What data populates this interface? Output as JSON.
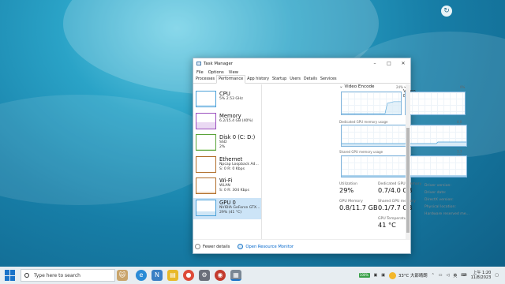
{
  "window": {
    "title": "Task Manager",
    "menu": [
      "File",
      "Options",
      "View"
    ],
    "tabs": [
      "Processes",
      "Performance",
      "App history",
      "Startup",
      "Users",
      "Details",
      "Services"
    ],
    "active_tab": "Performance"
  },
  "sidebar": {
    "items": [
      {
        "name": "CPU",
        "line1": "5% 2.53 GHz",
        "line2": ""
      },
      {
        "name": "Memory",
        "line1": "6.2/15.4 GB (40%)",
        "line2": ""
      },
      {
        "name": "Disk 0 (C: D:)",
        "line1": "SSD",
        "line2": "2%"
      },
      {
        "name": "Ethernet",
        "line1": "Npcap Loopback Ad...",
        "line2": "S: 0 R: 0 Kbps"
      },
      {
        "name": "Wi-Fi",
        "line1": "WLAN",
        "line2": "S: 0 R: 304 Kbps"
      },
      {
        "name": "GPU 0",
        "line1": "NVIDIA GeForce GTX...",
        "line2": "29% (41 °C)"
      }
    ]
  },
  "graphs": {
    "video_encode": {
      "label": "Video Encode",
      "pct": "24%"
    },
    "video_decode": {
      "label": "Video Decode",
      "pct": "0%"
    },
    "dedicated": {
      "label": "Dedicated GPU memory usage",
      "max": "4.0 GB"
    },
    "shared": {
      "label": "Shared GPU memory usage",
      "max": "7.7 GB"
    }
  },
  "stats": {
    "utilization": {
      "label": "Utilization",
      "value": "29%"
    },
    "dedicated_mem": {
      "label": "Dedicated GPU memory",
      "value": "0.7/4.0 GB"
    },
    "gpu_memory": {
      "label": "GPU Memory",
      "value": "0.8/11.7 GB"
    },
    "shared_mem": {
      "label": "Shared GPU memory",
      "value": "0.1/7.7 GB"
    },
    "gpu_temp": {
      "label": "GPU Temperature",
      "value": "41 °C"
    },
    "right_labels": [
      "Driver version:",
      "Driver date:",
      "DirectX version:",
      "Physical location:",
      "Hardware reserved me..."
    ]
  },
  "footer": {
    "fewer_details": "Fewer details",
    "open_monitor": "Open Resource Monitor"
  },
  "taskbar": {
    "search_placeholder": "Type here to search",
    "weather": "33°C 大部晴朗",
    "time": "上午 1:20",
    "date": "11/8/2023",
    "lang": "英",
    "badge": "100%"
  },
  "colors": {
    "cpu": "#4aa0d8",
    "memory": "#9a4fbf",
    "disk": "#5aa33a",
    "network": "#b06e2a",
    "gpu": "#4aa0d8"
  }
}
